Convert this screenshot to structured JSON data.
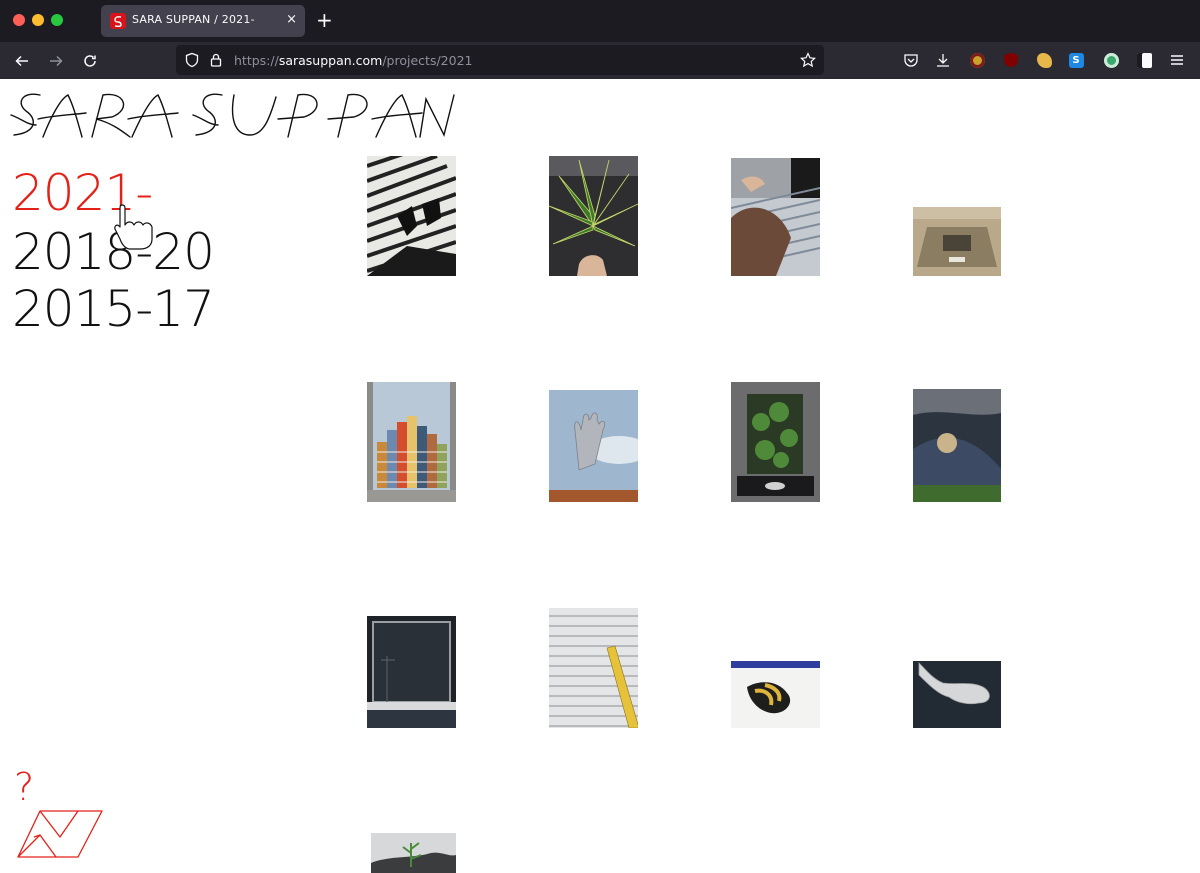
{
  "browser": {
    "tab_title": "SARA SUPPAN / 2021-",
    "tab_close": "×",
    "new_tab": "+",
    "url_protocol": "https://",
    "url_host": "sarasuppan.com",
    "url_path": "/projects/2021"
  },
  "site": {
    "logo_text": "SARA SUPPAN",
    "nav": [
      {
        "label": "2021-",
        "active": true
      },
      {
        "label": "2018-20",
        "active": false
      },
      {
        "label": "2015-17",
        "active": false
      }
    ],
    "info_label": "?",
    "accent_color": "#e32119"
  },
  "gallery": {
    "thumbnails": [
      "bed-sheets-legs",
      "plant-hand",
      "striped-shirt-knee",
      "car-roof-desert",
      "window-stacked-towers",
      "glove-sky",
      "plant-window-panel",
      "sleeping-figure",
      "dark-window",
      "siding-ruler",
      "gloves-stripe",
      "hand-dark",
      "small-plant"
    ]
  }
}
